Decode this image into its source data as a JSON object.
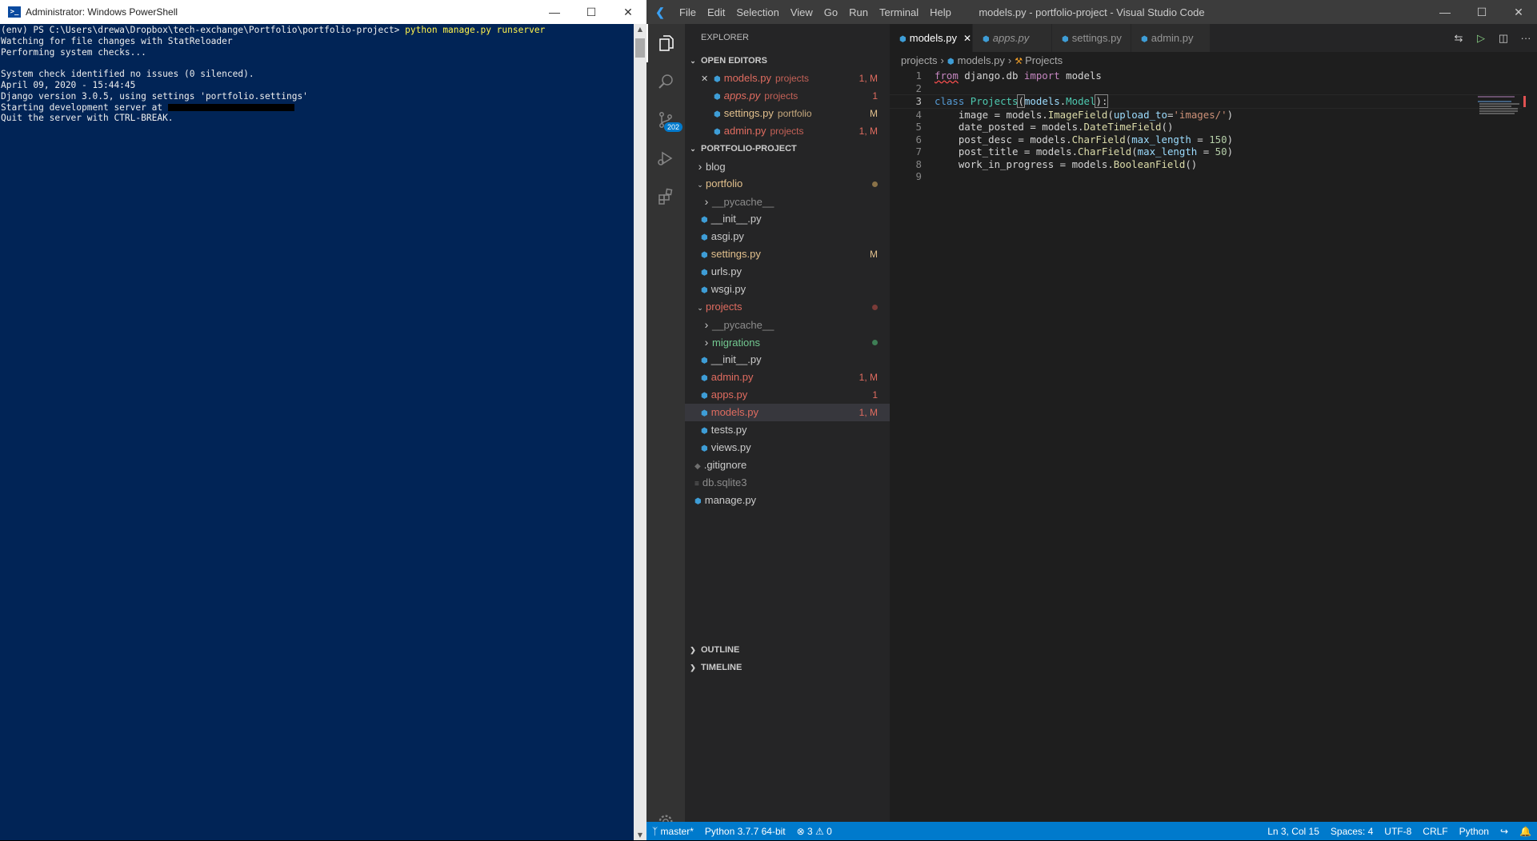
{
  "powershell": {
    "title": "Administrator: Windows PowerShell",
    "lines": [
      {
        "prefix": "(env) PS C:\\Users\\drewa\\Dropbox\\tech-exchange\\Portfolio\\portfolio-project> ",
        "cmd": "python manage.py runserver"
      },
      {
        "text": "Watching for file changes with StatReloader"
      },
      {
        "text": "Performing system checks..."
      },
      {
        "text": ""
      },
      {
        "text": "System check identified no issues (0 silenced)."
      },
      {
        "text": "April 09, 2020 - 15:44:45"
      },
      {
        "text": "Django version 3.0.5, using settings 'portfolio.settings'"
      },
      {
        "text": "Starting development server at ",
        "redacted": true
      },
      {
        "text": "Quit the server with CTRL-BREAK."
      }
    ]
  },
  "vscode": {
    "window_title": "models.py - portfolio-project - Visual Studio Code",
    "menu": [
      "File",
      "Edit",
      "Selection",
      "View",
      "Go",
      "Run",
      "Terminal",
      "Help"
    ],
    "scm_badge": "202",
    "explorer_label": "EXPLORER",
    "open_editors": {
      "label": "OPEN EDITORS",
      "items": [
        {
          "name": "models.py",
          "desc": "projects",
          "status": "1, M",
          "color": "red",
          "italic": false,
          "close": true
        },
        {
          "name": "apps.py",
          "desc": "projects",
          "status": "1",
          "color": "red",
          "italic": true,
          "close": false
        },
        {
          "name": "settings.py",
          "desc": "portfolio",
          "status": "M",
          "color": "yel",
          "italic": false,
          "close": false
        },
        {
          "name": "admin.py",
          "desc": "projects",
          "status": "1, M",
          "color": "red",
          "italic": false,
          "close": false
        }
      ]
    },
    "project": {
      "label": "PORTFOLIO-PROJECT",
      "tree": [
        {
          "name": "blog",
          "type": "folder",
          "depth": 0,
          "open": false,
          "color": "plain"
        },
        {
          "name": "portfolio",
          "type": "folder",
          "depth": 0,
          "open": true,
          "color": "yel",
          "dot": "#8a7248"
        },
        {
          "name": "__pycache__",
          "type": "folder",
          "depth": 1,
          "open": false,
          "color": "gry"
        },
        {
          "name": "__init__.py",
          "type": "py",
          "depth": 1,
          "color": "plain"
        },
        {
          "name": "asgi.py",
          "type": "py",
          "depth": 1,
          "color": "plain"
        },
        {
          "name": "settings.py",
          "type": "py",
          "depth": 1,
          "color": "yel",
          "status": "M"
        },
        {
          "name": "urls.py",
          "type": "py",
          "depth": 1,
          "color": "plain"
        },
        {
          "name": "wsgi.py",
          "type": "py",
          "depth": 1,
          "color": "plain"
        },
        {
          "name": "projects",
          "type": "folder",
          "depth": 0,
          "open": true,
          "color": "red",
          "dot": "#7a3b38"
        },
        {
          "name": "__pycache__",
          "type": "folder",
          "depth": 1,
          "open": false,
          "color": "gry"
        },
        {
          "name": "migrations",
          "type": "folder",
          "depth": 1,
          "open": false,
          "color": "grn",
          "dot": "#3e7e55"
        },
        {
          "name": "__init__.py",
          "type": "py",
          "depth": 1,
          "color": "plain"
        },
        {
          "name": "admin.py",
          "type": "py",
          "depth": 1,
          "color": "red",
          "status": "1, M"
        },
        {
          "name": "apps.py",
          "type": "py",
          "depth": 1,
          "color": "red",
          "status": "1"
        },
        {
          "name": "models.py",
          "type": "py",
          "depth": 1,
          "color": "red",
          "status": "1, M",
          "selected": true
        },
        {
          "name": "tests.py",
          "type": "py",
          "depth": 1,
          "color": "plain"
        },
        {
          "name": "views.py",
          "type": "py",
          "depth": 1,
          "color": "plain"
        },
        {
          "name": ".gitignore",
          "type": "git",
          "depth": 0,
          "color": "plain"
        },
        {
          "name": "db.sqlite3",
          "type": "db",
          "depth": 0,
          "color": "gry"
        },
        {
          "name": "manage.py",
          "type": "py",
          "depth": 0,
          "color": "plain"
        }
      ]
    },
    "outline_label": "OUTLINE",
    "timeline_label": "TIMELINE",
    "tabs": [
      {
        "label": "models.py",
        "active": true,
        "italic": false
      },
      {
        "label": "apps.py",
        "active": false,
        "italic": true
      },
      {
        "label": "settings.py",
        "active": false,
        "italic": false
      },
      {
        "label": "admin.py",
        "active": false,
        "italic": false
      }
    ],
    "breadcrumb": [
      "projects",
      "models.py",
      "Projects"
    ],
    "code_lines": [
      [
        [
          "kw",
          "from"
        ],
        [
          "pl",
          " django.db "
        ],
        [
          "kw",
          "import"
        ],
        [
          "pl",
          " models"
        ]
      ],
      [],
      [
        [
          "kw2",
          "class"
        ],
        [
          "pl",
          " "
        ],
        [
          "cls",
          "Projects"
        ],
        [
          "pl",
          "("
        ],
        [
          "prm",
          "models"
        ],
        [
          "pl",
          "."
        ],
        [
          "cls",
          "Model"
        ],
        [
          "pl",
          "):"
        ]
      ],
      [
        [
          "pl",
          "    image = models."
        ],
        [
          "fn",
          "ImageField"
        ],
        [
          "pl",
          "("
        ],
        [
          "prm",
          "upload_to"
        ],
        [
          "pl",
          "="
        ],
        [
          "str",
          "'images/'"
        ],
        [
          "pl",
          ")"
        ]
      ],
      [
        [
          "pl",
          "    date_posted = models."
        ],
        [
          "fn",
          "DateTimeField"
        ],
        [
          "pl",
          "()"
        ]
      ],
      [
        [
          "pl",
          "    post_desc = models."
        ],
        [
          "fn",
          "CharField"
        ],
        [
          "pl",
          "("
        ],
        [
          "prm",
          "max_length"
        ],
        [
          "pl",
          " = "
        ],
        [
          "numc",
          "150"
        ],
        [
          "pl",
          ")"
        ]
      ],
      [
        [
          "pl",
          "    post_title = models."
        ],
        [
          "fn",
          "CharField"
        ],
        [
          "pl",
          "("
        ],
        [
          "prm",
          "max_length"
        ],
        [
          "pl",
          " = "
        ],
        [
          "numc",
          "50"
        ],
        [
          "pl",
          ")"
        ]
      ],
      [
        [
          "pl",
          "    work_in_progress = models."
        ],
        [
          "fn",
          "BooleanField"
        ],
        [
          "pl",
          "()"
        ]
      ],
      []
    ],
    "status": {
      "branch": "master*",
      "python": "Python 3.7.7 64-bit",
      "errors": "3",
      "warnings": "0",
      "position": "Ln 3, Col 15",
      "spaces": "Spaces: 4",
      "encoding": "UTF-8",
      "eol": "CRLF",
      "language": "Python"
    }
  }
}
